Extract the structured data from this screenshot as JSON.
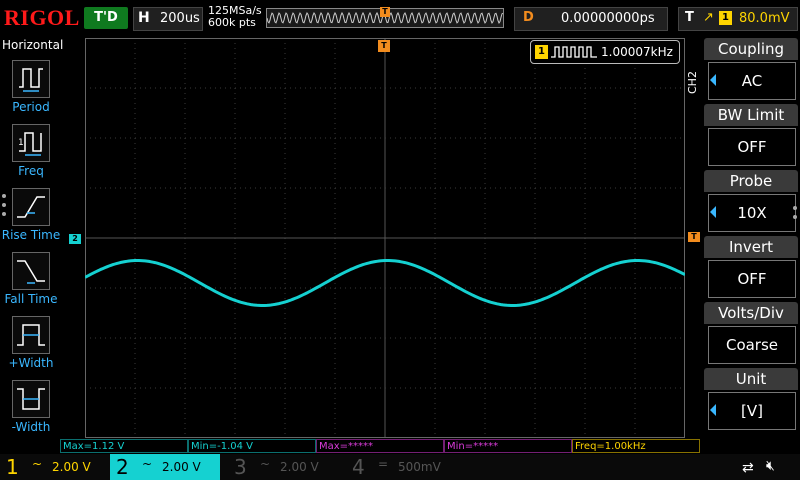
{
  "topbar": {
    "brand": "RIGOL",
    "run_status": "T'D",
    "h_label": "H",
    "timebase": "200us",
    "sample_rate": "125MSa/s",
    "mem_depth": "600k pts",
    "delay_label": "D",
    "delay_value": "0.00000000ps",
    "trig_label": "T",
    "trig_source": "1",
    "trig_level": "80.0mV",
    "trig_marker": "T"
  },
  "left_menu": {
    "title": "Horizontal",
    "items": [
      {
        "label": "Period",
        "icon": "period-icon"
      },
      {
        "label": "Freq",
        "icon": "freq-icon"
      },
      {
        "label": "Rise Time",
        "icon": "rise-time-icon"
      },
      {
        "label": "Fall Time",
        "icon": "fall-time-icon"
      },
      {
        "label": "+Width",
        "icon": "pos-width-icon"
      },
      {
        "label": "-Width",
        "icon": "neg-width-icon"
      }
    ]
  },
  "freq_counter": {
    "channel": "1",
    "value": "1.00007kHz"
  },
  "markers": {
    "ch2": "2",
    "trigger": "T"
  },
  "right_menu": {
    "channel": "CH2",
    "items": [
      {
        "title": "Coupling",
        "value": "AC",
        "arrow": true
      },
      {
        "title": "BW Limit",
        "value": "OFF",
        "arrow": false
      },
      {
        "title": "Probe",
        "value": "10X",
        "arrow": true
      },
      {
        "title": "Invert",
        "value": "OFF",
        "arrow": false
      },
      {
        "title": "Volts/Div",
        "value": "Coarse",
        "arrow": false
      },
      {
        "title": "Unit",
        "value": "[V]",
        "arrow": true
      }
    ]
  },
  "measurements": [
    {
      "text": "Max=1.12 V",
      "color": "#15d1d1"
    },
    {
      "text": "Min=-1.04 V",
      "color": "#15d1d1"
    },
    {
      "text": "Max=*****",
      "color": "#d93bd9"
    },
    {
      "text": "Min=*****",
      "color": "#d93bd9"
    },
    {
      "text": "Freq=1.00kHz",
      "color": "#ffd500"
    }
  ],
  "channels": [
    {
      "num": "1",
      "coupling": "~",
      "scale": "2.00 V",
      "color": "#ffd500",
      "active": false
    },
    {
      "num": "2",
      "coupling": "~",
      "scale": "2.00 V",
      "color": "#15d1d1",
      "active": true
    },
    {
      "num": "3",
      "coupling": "~",
      "scale": "2.00 V",
      "color": "#555555",
      "active": false
    },
    {
      "num": "4",
      "coupling": "=",
      "scale": "500mV",
      "color": "#555555",
      "active": false
    }
  ],
  "colors": {
    "ch1": "#ffd500",
    "ch2": "#15d1d1",
    "trigger": "#f28c1e",
    "brand": "#ff1a1a",
    "menu_accent": "#3ab7ff"
  },
  "waveform": {
    "channel": "2",
    "shape": "sine",
    "screen_cycles": 2.4,
    "peak_div": 0.45,
    "offset_div": 0.9
  }
}
